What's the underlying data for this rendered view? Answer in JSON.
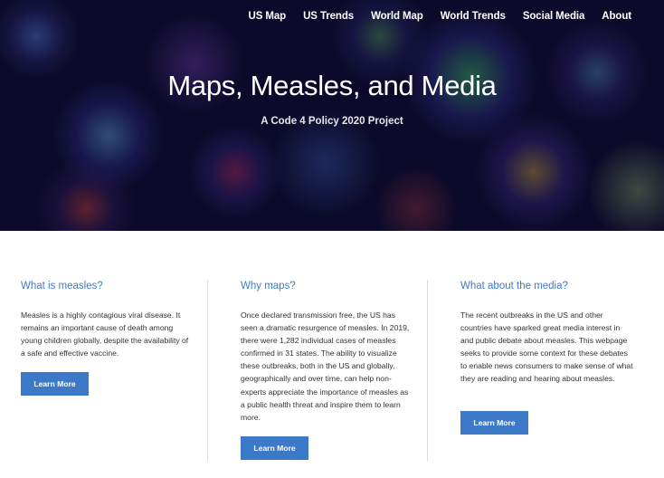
{
  "nav": {
    "items": [
      "US Map",
      "US Trends",
      "World Map",
      "World Trends",
      "Social Media",
      "About"
    ]
  },
  "hero": {
    "title": "Maps, Measles, and Media",
    "subtitle": "A Code 4 Policy 2020 Project"
  },
  "columns": [
    {
      "heading": "What is measles?",
      "body": "Measles is a highly contagious viral disease. It remains an important cause of death among young children globally, despite the availability of a safe and effective vaccine.",
      "button": "Learn More"
    },
    {
      "heading": "Why maps?",
      "body": "Once declared transmission free, the US has seen a dramatic resurgence of measles. In 2019, there were 1,282 individual cases of measles confirmed in 31 states. The ability to visualize these outbreaks, both in the US and globally, geographically and over time, can help non-experts appreciate the importance of measles as a public health threat and inspire them to learn more.",
      "button": "Learn More"
    },
    {
      "heading": "What about the media?",
      "body": "The recent outbreaks in the US and other countries have sparked great media interest in and public debate about measles. This webpage seeks to provide some context for these debates to enable news consumers to make sense of what they are reading and hearing about measles.",
      "button": "Learn More"
    }
  ],
  "colors": {
    "accent": "#3d79c9",
    "heading": "#3f7ac9",
    "hero_bg": "#0f0c2e"
  }
}
